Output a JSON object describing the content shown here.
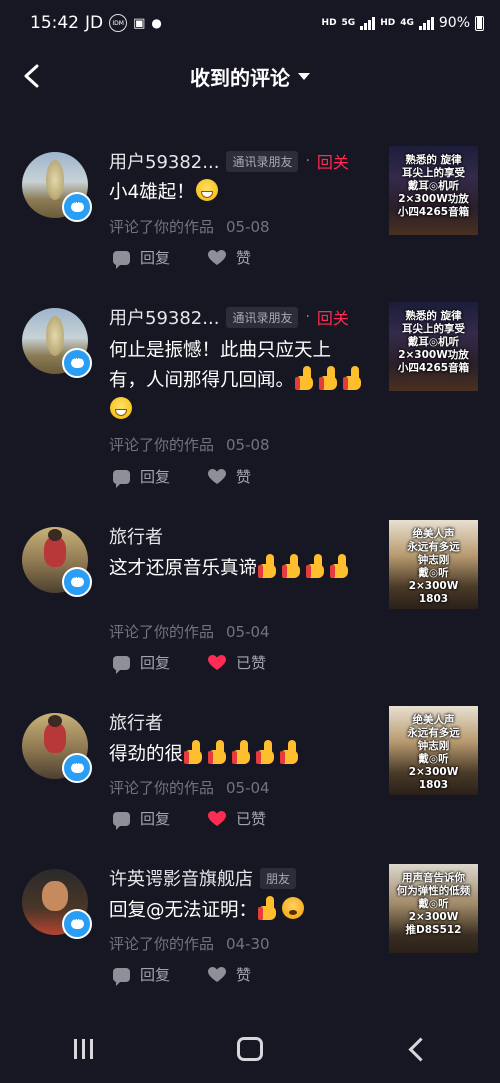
{
  "status_bar": {
    "time": "15:42",
    "carrier": "JD",
    "indicator": "IDM",
    "hd1": "HD",
    "net1": "5G",
    "hd2": "HD",
    "net2": "4G",
    "battery": "90%"
  },
  "header": {
    "title": "收到的评论"
  },
  "colors": {
    "accent_red": "#fe2c55",
    "liked_red": "#fe2c55",
    "badge_blue": "#2a9df4",
    "background": "#161722"
  },
  "comments": [
    {
      "user": "用户59382...",
      "tag": "通讯录朋友",
      "follow": "回关",
      "text": "小4雄起！",
      "meta": "评论了你的作品",
      "date": "05-08",
      "reply_label": "回复",
      "like_label": "赞",
      "liked": false,
      "thumb_text": "熟悉的  旋律\n耳尖上的享受\n戴耳◎机听\n2×300W功放\n小四4265音箱"
    },
    {
      "user": "用户59382...",
      "tag": "通讯录朋友",
      "follow": "回关",
      "text": "何止是振憾！此曲只应天上有，人间那得几回闻。",
      "meta": "评论了你的作品",
      "date": "05-08",
      "reply_label": "回复",
      "like_label": "赞",
      "liked": false,
      "thumb_text": "熟悉的  旋律\n耳尖上的享受\n戴耳◎机听\n2×300W功放\n小四4265音箱"
    },
    {
      "user": "旅行者",
      "text": "这才还原音乐真谛",
      "meta": "评论了你的作品",
      "date": "05-04",
      "reply_label": "回复",
      "like_label": "已赞",
      "liked": true,
      "thumb_text": "绝美人声\n永远有多远\n钟志刚\n戴◎听\n2×300W\n1803"
    },
    {
      "user": "旅行者",
      "text": "得劲的很",
      "meta": "评论了你的作品",
      "date": "05-04",
      "reply_label": "回复",
      "like_label": "已赞",
      "liked": true,
      "thumb_text": "绝美人声\n永远有多远\n钟志刚\n戴◎听\n2×300W\n1803"
    },
    {
      "user": "许英谔影音旗舰店",
      "tag": "朋友",
      "text": "回复@无法证明：",
      "meta": "评论了你的作品",
      "date": "04-30",
      "reply_label": "回复",
      "like_label": "赞",
      "liked": false,
      "thumb_text": "用声音告诉你\n何为弹性的低频\n戴◎听\n2×300W\n推D8S512"
    }
  ],
  "icons": {
    "back": "chevron-left-icon",
    "dropdown": "caret-down-icon",
    "badge": "message-bubble-icon",
    "reply": "comment-bubble-icon",
    "like": "heart-icon",
    "nav_recents": "recents-icon",
    "nav_home": "home-icon",
    "nav_back": "back-icon"
  }
}
